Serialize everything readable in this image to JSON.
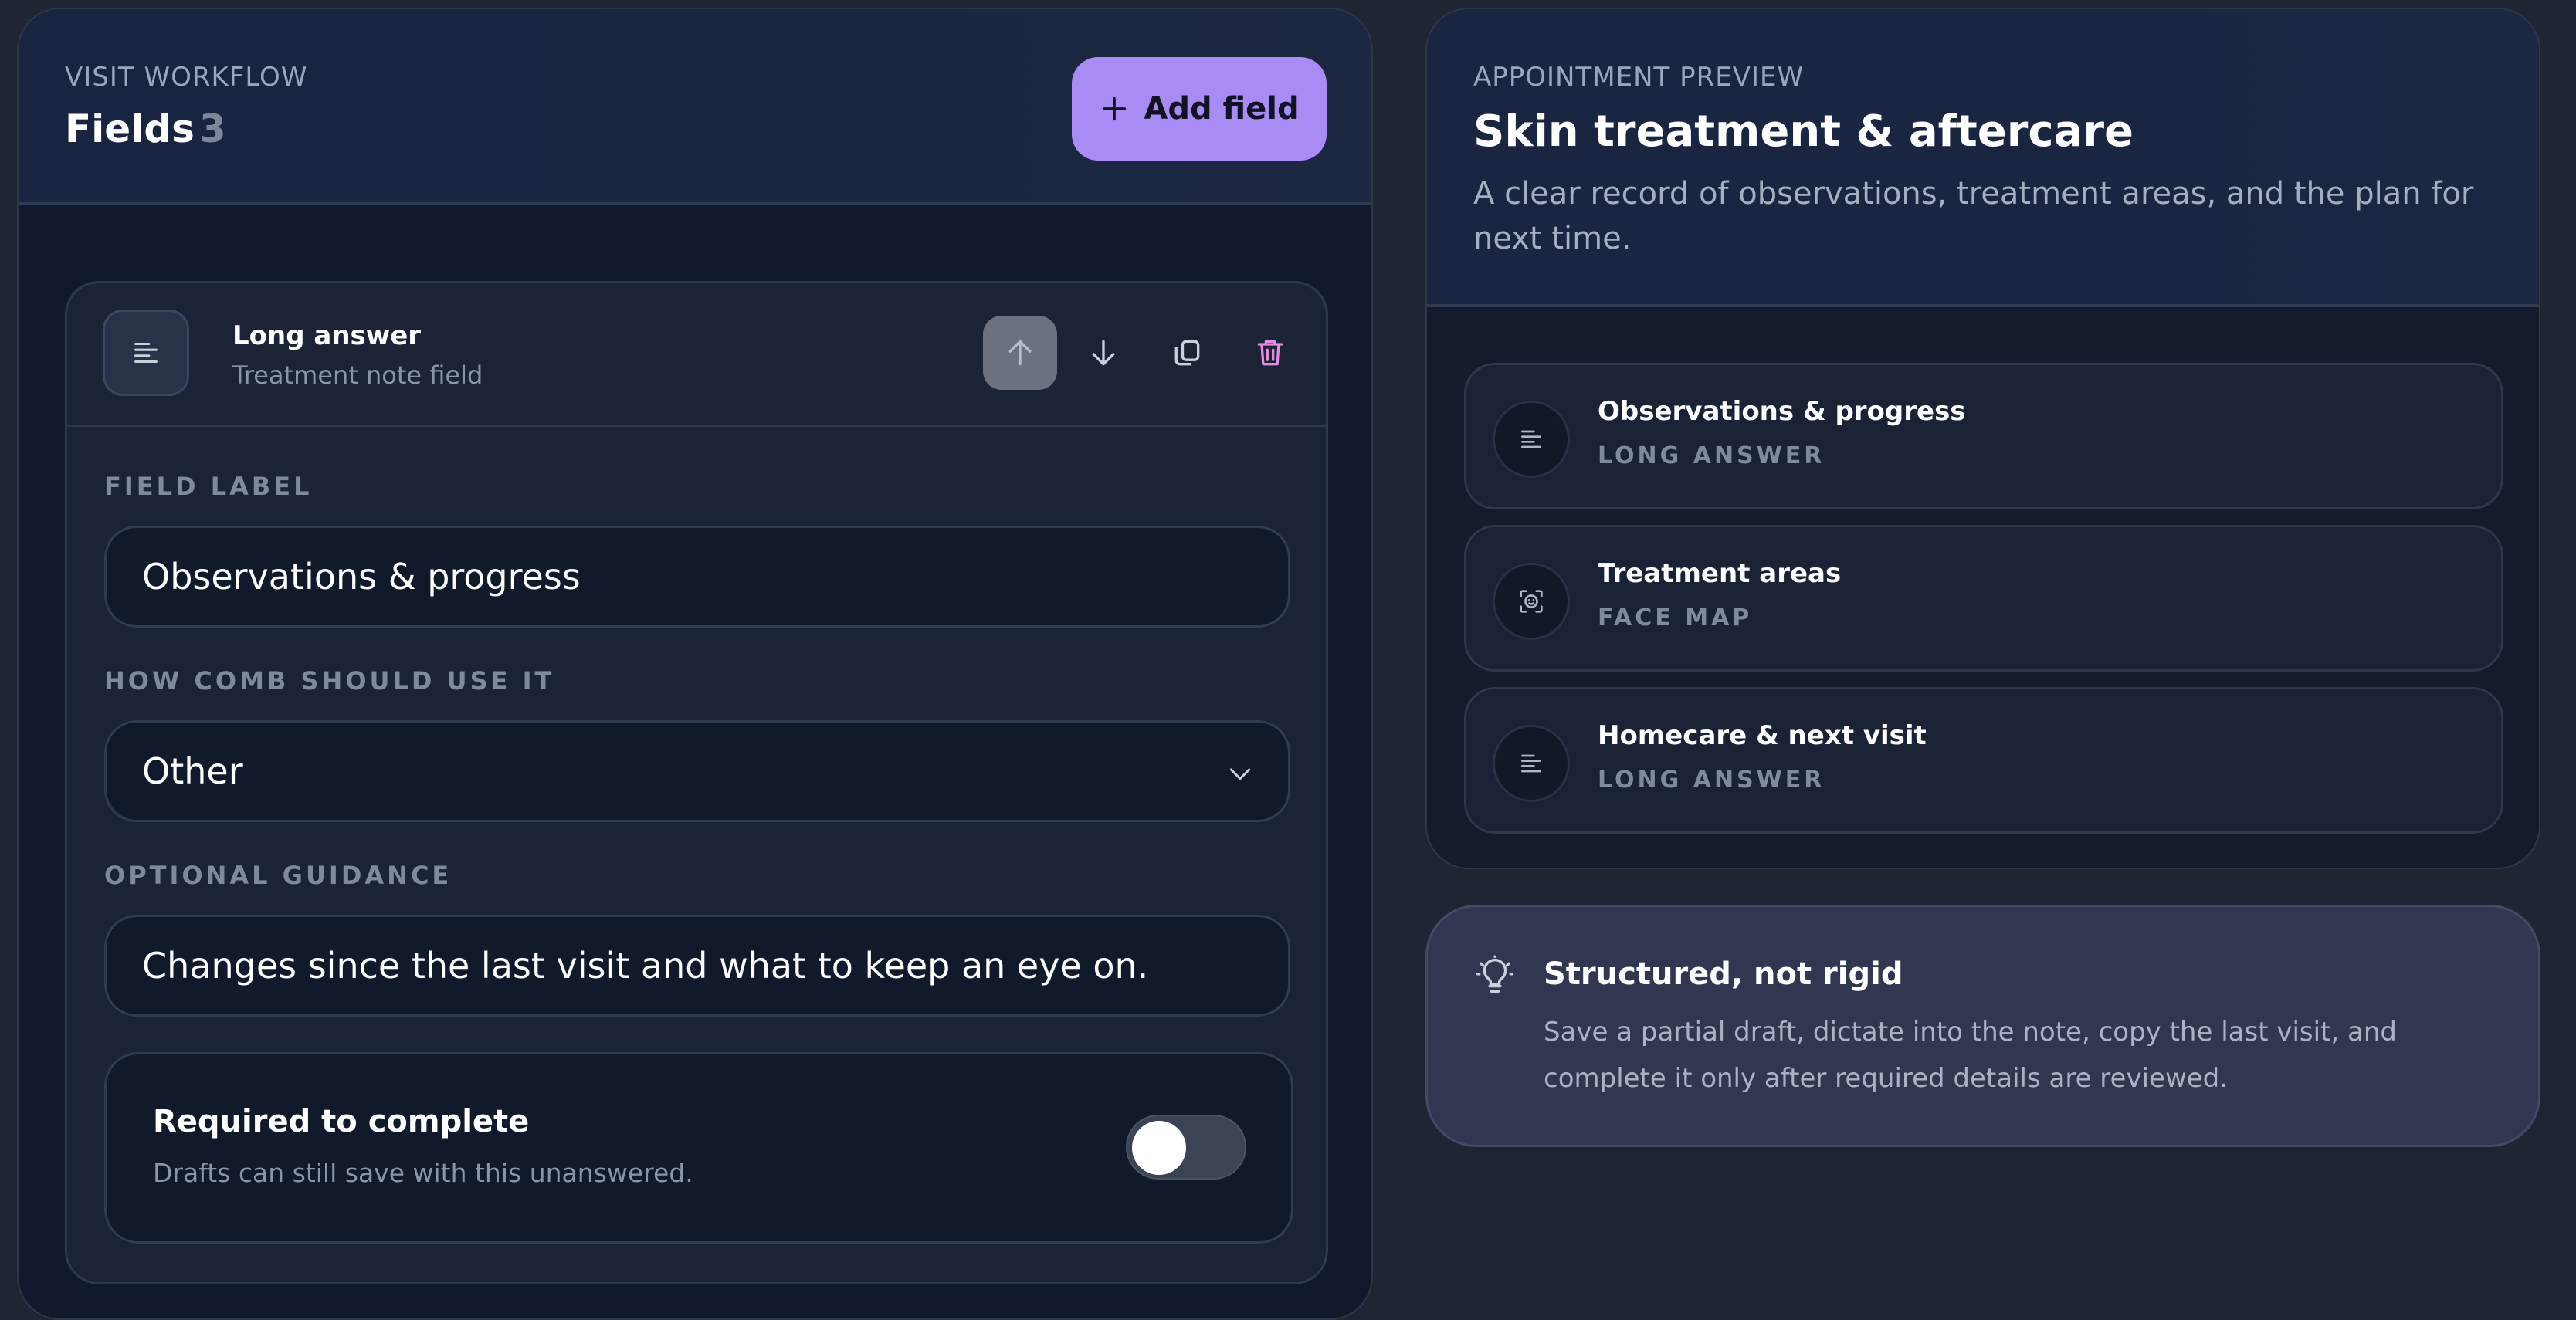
{
  "workflow": {
    "eyebrow": "VISIT WORKFLOW",
    "title": "Fields",
    "count": "3",
    "add_button": "Add field"
  },
  "field_card": {
    "type_title": "Long answer",
    "type_subtitle": "Treatment note field",
    "label_caption": "FIELD LABEL",
    "label_value": "Observations & progress",
    "usage_caption": "HOW COMB SHOULD USE IT",
    "usage_value": "Other",
    "guidance_caption": "OPTIONAL GUIDANCE",
    "guidance_value": "Changes since the last visit and what to keep an eye on.",
    "required_title": "Required to complete",
    "required_subtitle": "Drafts can still save with this unanswered.",
    "required_on": false
  },
  "preview": {
    "eyebrow": "APPOINTMENT PREVIEW",
    "title": "Skin treatment & aftercare",
    "description": "A clear record of observations, treatment areas, and the plan for next time.",
    "items": [
      {
        "title": "Observations & progress",
        "type": "LONG ANSWER",
        "icon": "text-lines-icon"
      },
      {
        "title": "Treatment areas",
        "type": "FACE MAP",
        "icon": "face-scan-icon"
      },
      {
        "title": "Homecare & next visit",
        "type": "LONG ANSWER",
        "icon": "text-lines-icon"
      }
    ]
  },
  "tip": {
    "title": "Structured, not rigid",
    "body": "Save a partial draft, dictate into the note, copy the last visit, and complete it only after required details are reviewed."
  },
  "colors": {
    "accent": "#a98bf5",
    "delete": "#e58ce0",
    "background": "#1f2633"
  }
}
